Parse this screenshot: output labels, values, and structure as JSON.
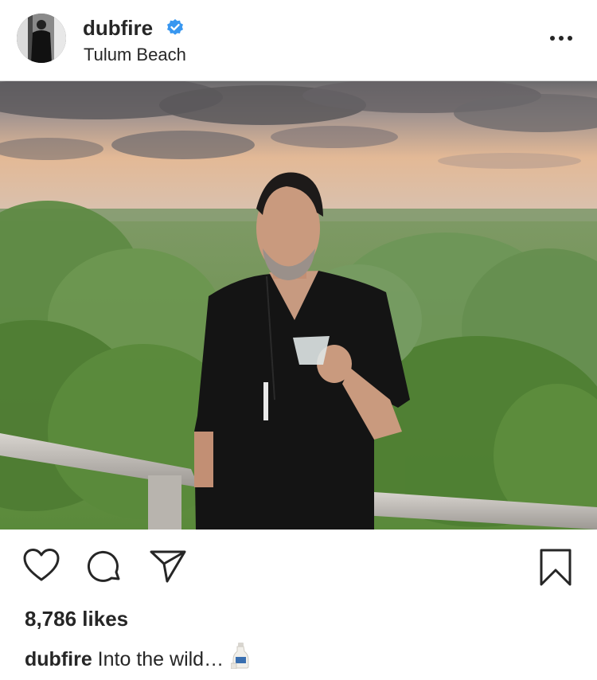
{
  "post": {
    "username": "dubfire",
    "verified": true,
    "location": "Tulum Beach",
    "photo": {
      "alt_icon": "photo-image",
      "colors": {
        "sky_top": "#6e6a6a",
        "sunset": "#e7b894",
        "horizon": "#d9c0ad",
        "foliage": "#5e8a3a",
        "shirt": "#161616",
        "railing": "#bdbab5"
      }
    }
  },
  "actions": {
    "like_icon": "heart-icon",
    "comment_icon": "comment-icon",
    "share_icon": "send-icon",
    "save_icon": "bookmark-icon"
  },
  "likes": {
    "text": "8,786 likes"
  },
  "caption": {
    "username": "dubfire",
    "text": "Into the wild…",
    "emoji_icon": "sake-bottle-icon"
  },
  "colors": {
    "verified_blue": "#3897f0",
    "text": "#262626",
    "divider": "#dbdbdb"
  }
}
